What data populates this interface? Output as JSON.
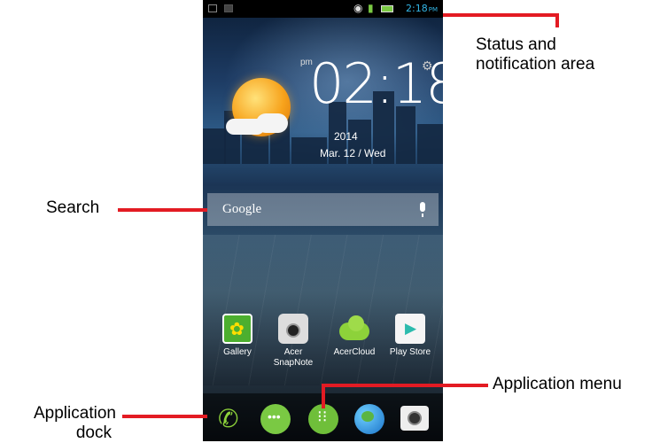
{
  "callouts": {
    "status": "Status and notification area",
    "status_line1": "Status and",
    "status_line2": "notification area",
    "search": "Search",
    "app_menu": "Application menu",
    "app_dock_line1": "Application",
    "app_dock_line2": "dock"
  },
  "statusbar": {
    "time": "2:18",
    "time_suffix": "PM"
  },
  "clock_widget": {
    "ampm": "pm",
    "time": "02:18",
    "year": "2014",
    "date": "Mar. 12 / Wed"
  },
  "search": {
    "label": "Google"
  },
  "apps": [
    {
      "label": "Gallery",
      "icon": "gallery-icon"
    },
    {
      "label": "Acer SnapNote",
      "label_line1": "Acer",
      "label_line2": "SnapNote",
      "icon": "snapnote-icon"
    },
    {
      "label": "AcerCloud",
      "icon": "acercloud-icon"
    },
    {
      "label": "Play Store",
      "icon": "play-store-icon"
    }
  ],
  "dock": [
    "phone-icon",
    "messaging-icon",
    "app-menu-icon",
    "browser-icon",
    "camera-icon"
  ],
  "colors": {
    "callout_red": "#e31b23",
    "status_blue": "#33b5e5",
    "dock_green": "#7ac943"
  }
}
